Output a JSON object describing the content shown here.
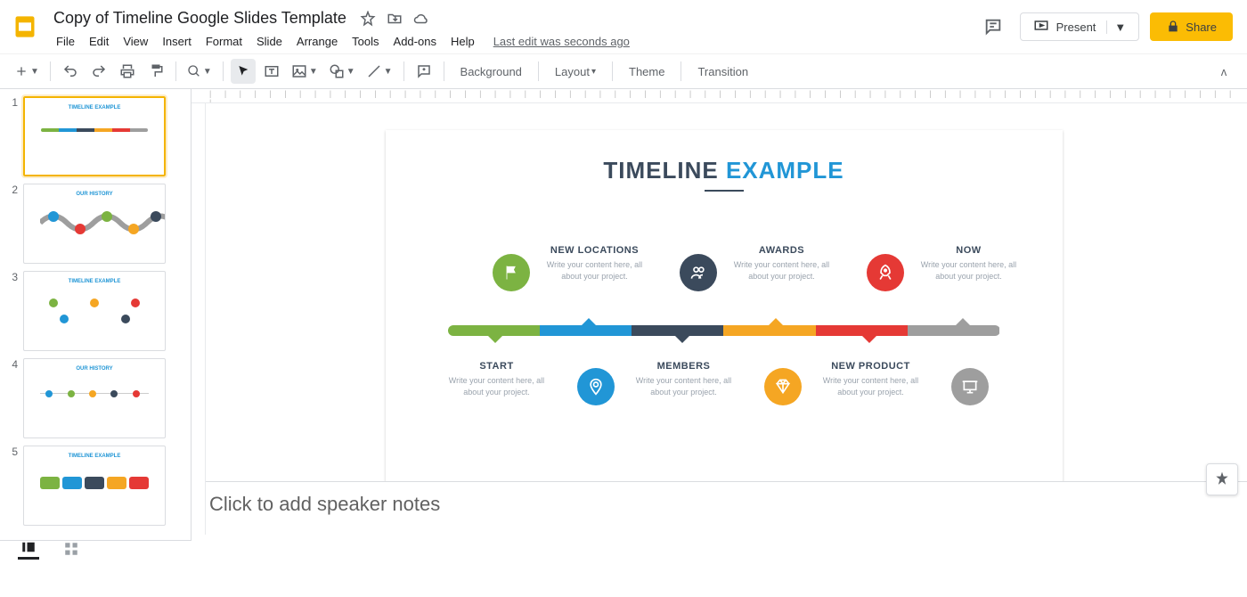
{
  "header": {
    "title": "Copy of Timeline Google Slides Template",
    "menus": [
      "File",
      "Edit",
      "View",
      "Insert",
      "Format",
      "Slide",
      "Arrange",
      "Tools",
      "Add-ons",
      "Help"
    ],
    "last_edit": "Last edit was seconds ago",
    "present": "Present",
    "share": "Share"
  },
  "toolbar": {
    "background": "Background",
    "layout": "Layout",
    "theme": "Theme",
    "transition": "Transition"
  },
  "filmstrip": [
    {
      "num": "1",
      "title1": "TIMELINE ",
      "title2": "EXAMPLE"
    },
    {
      "num": "2",
      "title1": "OUR ",
      "title2": "HISTORY"
    },
    {
      "num": "3",
      "title1": "TIMELINE ",
      "title2": "EXAMPLE"
    },
    {
      "num": "4",
      "title1": "OUR ",
      "title2": "HISTORY"
    },
    {
      "num": "5",
      "title1": "TIMELINE ",
      "title2": "EXAMPLE"
    }
  ],
  "slide": {
    "title1": "TIMELINE ",
    "title2": "EXAMPLE",
    "body_text": "Write your content here, all about your project.",
    "items_top": [
      {
        "heading": "NEW LOCATIONS"
      },
      {
        "heading": "AWARDS"
      },
      {
        "heading": "NOW"
      }
    ],
    "items_bottom": [
      {
        "heading": "START"
      },
      {
        "heading": "MEMBERS"
      },
      {
        "heading": "NEW PRODUCT"
      }
    ]
  },
  "notes": {
    "placeholder": "Click to add speaker notes"
  }
}
